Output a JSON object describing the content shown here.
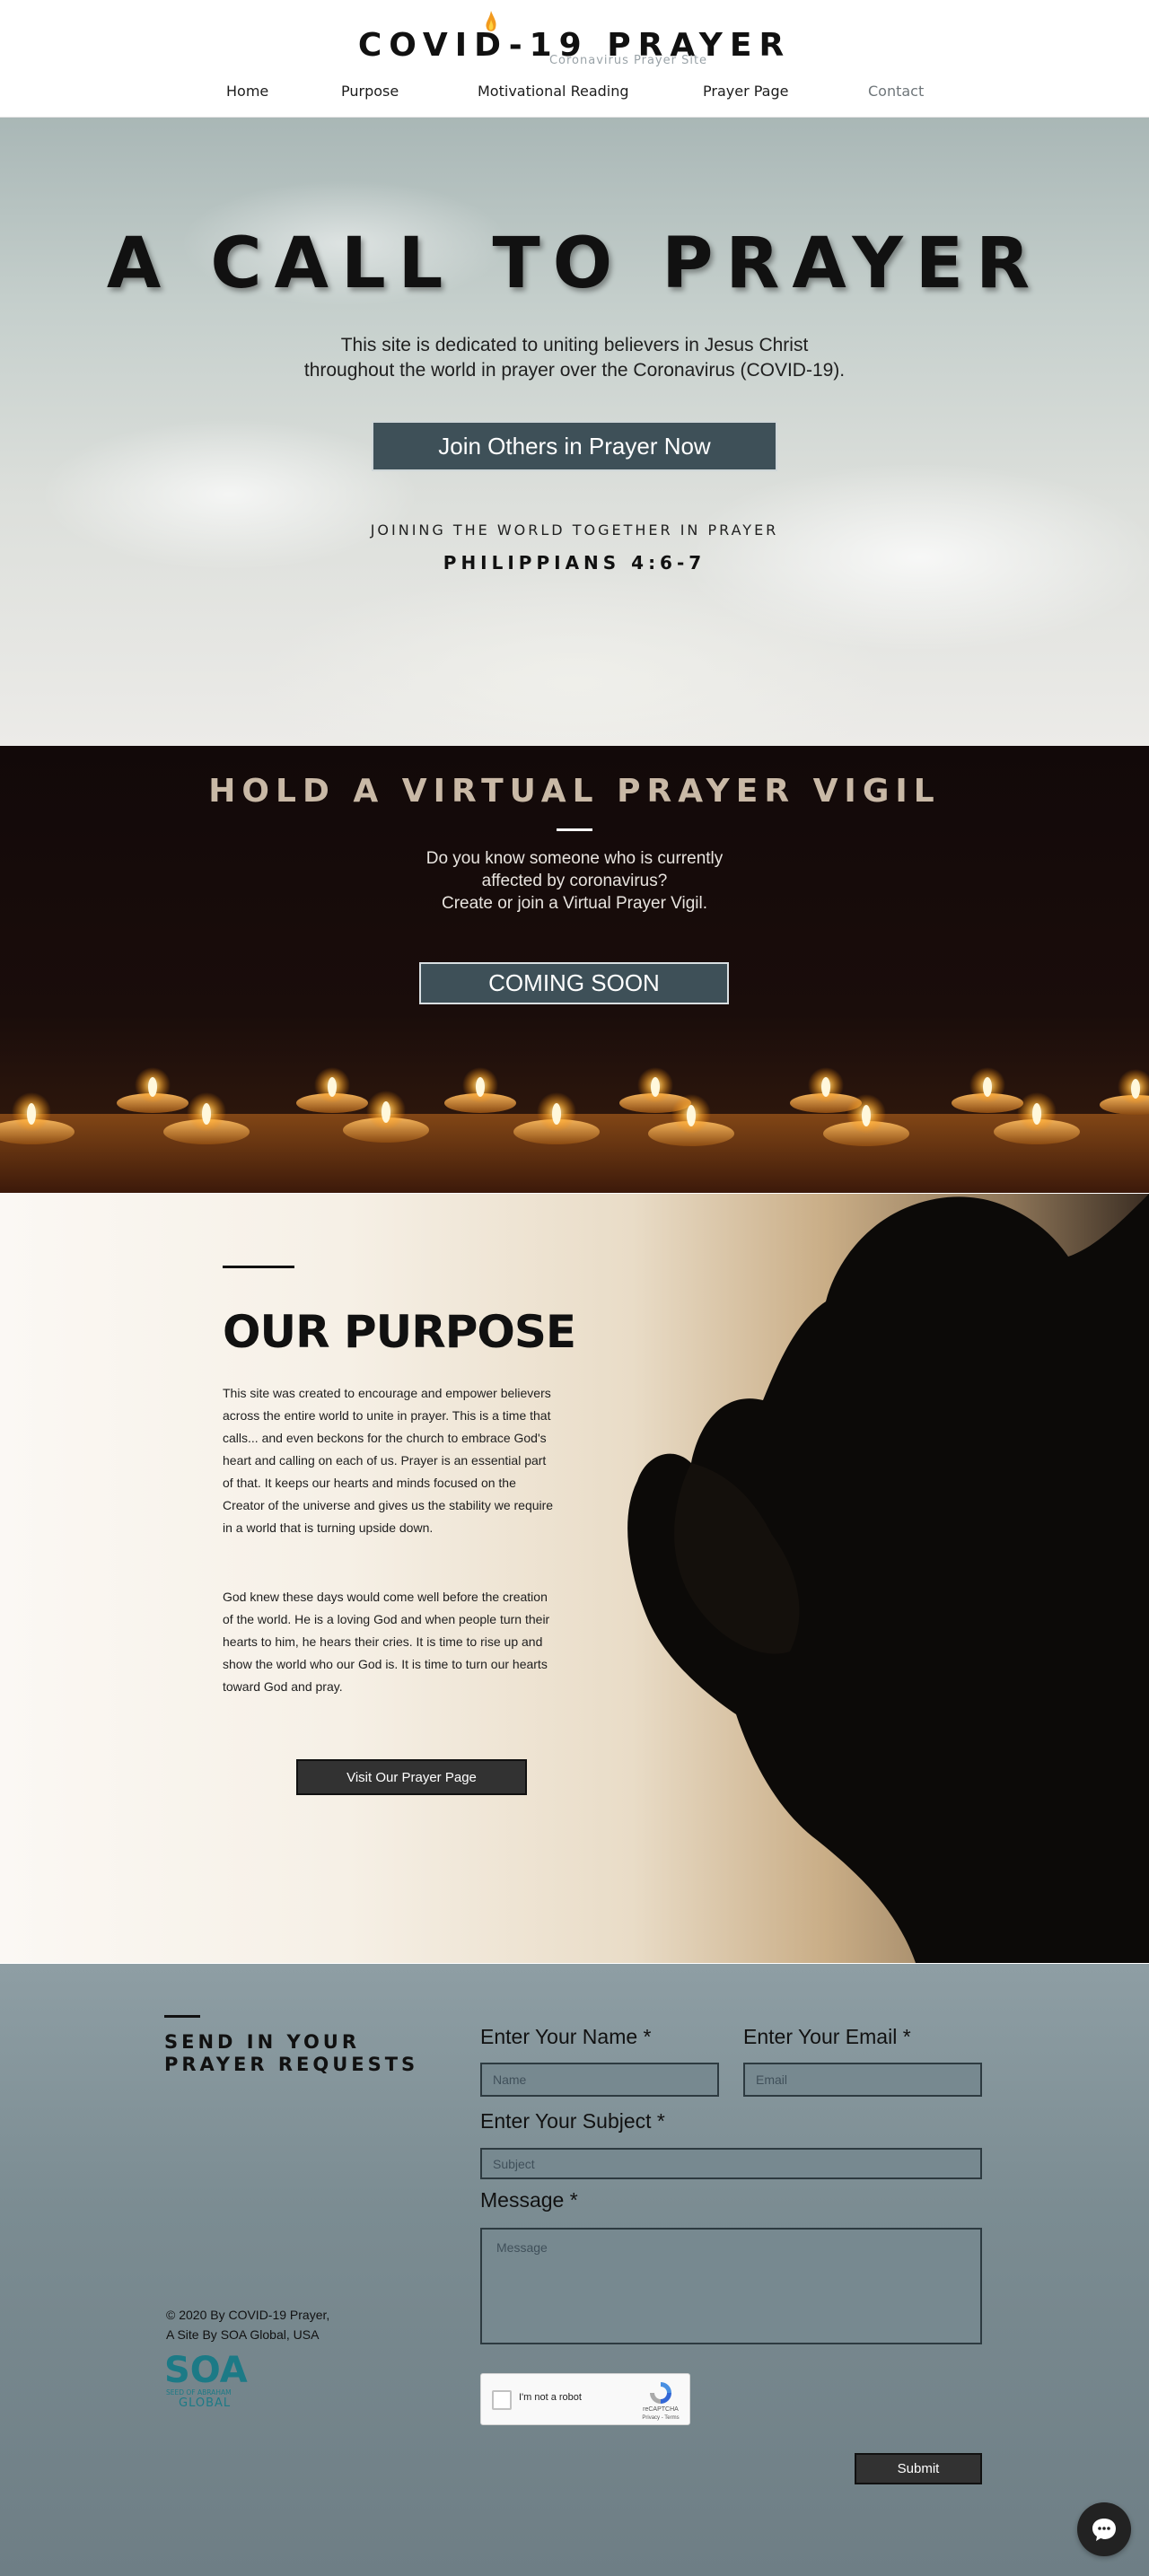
{
  "brand": {
    "logo_text": "COVID-19 PRAYER",
    "logo_subtitle": "Coronavirus Prayer Site"
  },
  "nav": {
    "items": [
      {
        "label": "Home"
      },
      {
        "label": "Purpose"
      },
      {
        "label": "Motivational Reading"
      },
      {
        "label": "Prayer Page"
      },
      {
        "label": "Contact"
      }
    ]
  },
  "hero": {
    "title": "A CALL TO PRAYER",
    "text_line1": "This site is dedicated to uniting believers in Jesus Christ",
    "text_line2": "throughout the world in prayer over the Coronavirus (COVID-19).",
    "button_label": "Join Others in Prayer Now",
    "tagline": "JOINING THE WORLD TOGETHER IN PRAYER",
    "verse": "PHILIPPIANS 4:6-7"
  },
  "vigil": {
    "title": "HOLD A VIRTUAL PRAYER VIGIL",
    "text_line1": "Do you know someone who is currently",
    "text_line2": "affected by coronavirus?",
    "text_line3": "Create or join a Virtual Prayer Vigil.",
    "button_label": "COMING SOON"
  },
  "purpose": {
    "title": "OUR PURPOSE",
    "paragraph1": "This site was created to encourage and empower believers across the entire world to unite in prayer. This is a time that calls... and even beckons for the church to embrace God's heart and calling on each of us. Prayer is an essential part of that. It keeps our hearts and minds focused on the Creator of the universe and gives us the stability we require in a world that is turning upside down.",
    "paragraph2": "God knew these days would come well before the creation of the world. He is a loving God and when people turn their hearts to him, he hears their cries. It is time to rise up and show the world who our God is. It is time to turn our hearts toward God and pray.",
    "button_label": "Visit Our Prayer Page"
  },
  "contact": {
    "title": "SEND IN YOUR PRAYER REQUESTS",
    "name_label": "Enter Your Name *",
    "name_placeholder": "Name",
    "email_label": "Enter Your Email *",
    "email_placeholder": "Email",
    "subject_label": "Enter Your Subject *",
    "subject_placeholder": "Subject",
    "message_label": "Message *",
    "message_placeholder": "Message",
    "captcha_label": "I'm not a robot",
    "captcha_brand": "reCAPTCHA",
    "captcha_links": "Privacy - Terms",
    "submit_label": "Submit",
    "copyright_line1": "© 2020 By COVID-19 Prayer,",
    "copyright_line2": "A Site By SOA Global, USA",
    "soa_logo_text": "SOA",
    "soa_logo_sub": "SEED OF ABRAHAM",
    "soa_logo_global": "GLOBAL"
  },
  "colors": {
    "button_dark_slate": "#3e5058",
    "button_charcoal": "#323232",
    "vigil_title": "#c9b9a6",
    "soa_teal": "#1c7a86"
  },
  "icons": {
    "chat": "chat-bubble-icon",
    "flame": "flame-icon",
    "recaptcha": "recaptcha-icon"
  }
}
